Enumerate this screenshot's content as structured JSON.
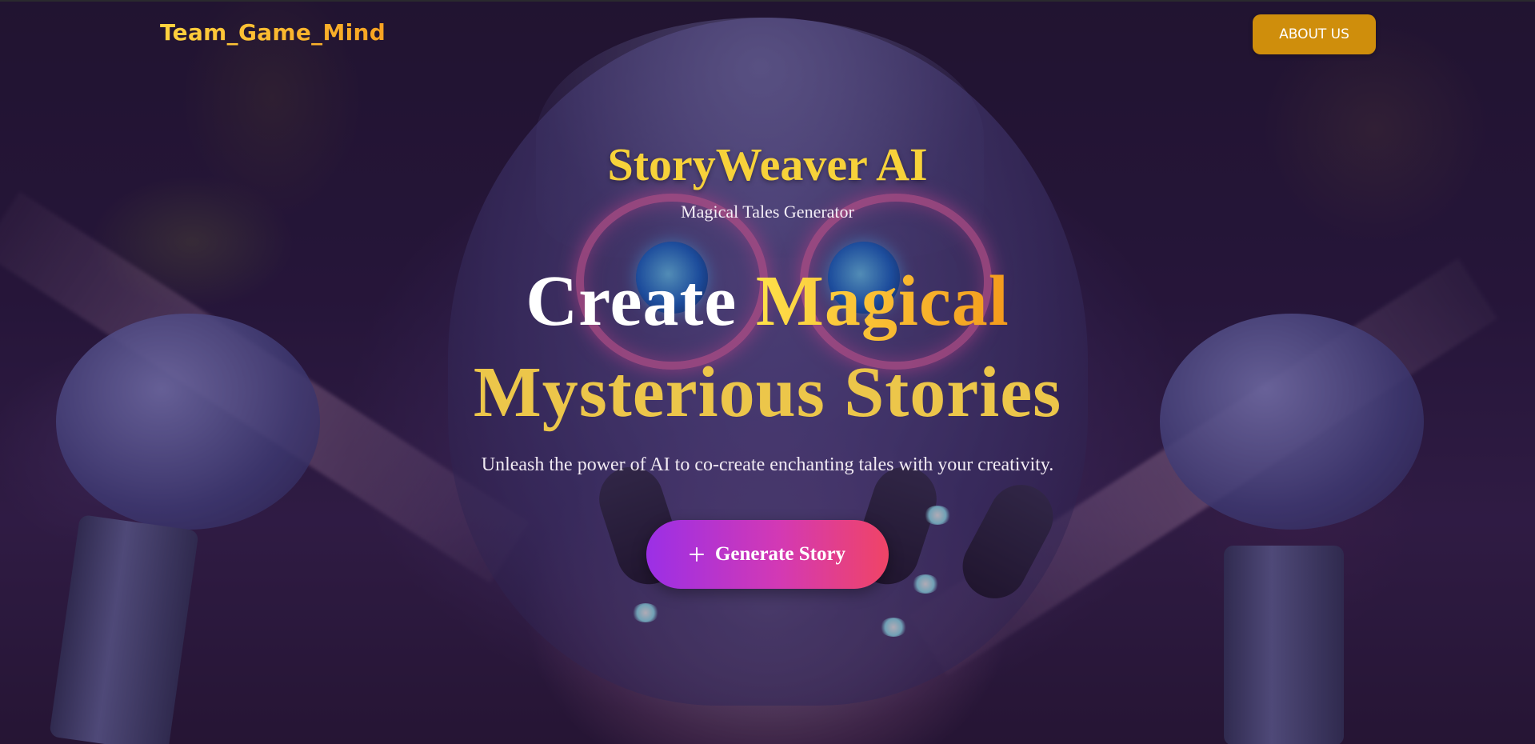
{
  "header": {
    "logo_text": "Team_Game_Mind",
    "about_label": "ABOUT US"
  },
  "hero": {
    "app_title": "StoryWeaver AI",
    "app_subtitle": "Magical Tales Generator",
    "headline": {
      "line1_word1": "Create",
      "line1_word2": "Magical",
      "line2": "Mysterious Stories"
    },
    "tagline": "Unleash the power of AI to co-create enchanting tales with your creativity.",
    "generate_label": "Generate Story"
  },
  "colors": {
    "accent_gold": "#f7d23a",
    "about_button": "#cf8e0c",
    "button_gradient_start": "#9b2fe6",
    "button_gradient_end": "#f04466"
  },
  "icons": {
    "generate_button_icon": "plus-icon"
  }
}
